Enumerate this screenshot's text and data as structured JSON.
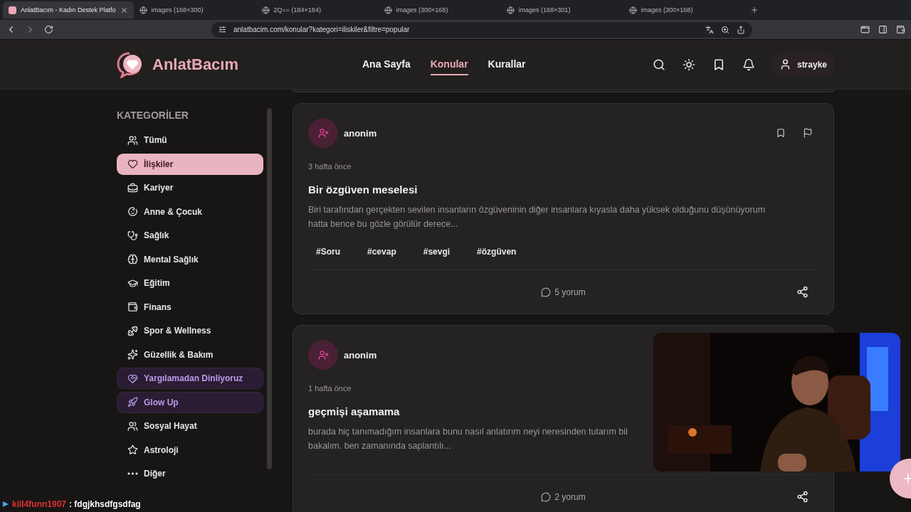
{
  "browser": {
    "tabs": [
      {
        "title": "AnlatBacım - Kadın Destek Platfo",
        "selected": true
      },
      {
        "title": "images (168×300)",
        "selected": false
      },
      {
        "title": "2Q== (184×184)",
        "selected": false
      },
      {
        "title": "images (300×168)",
        "selected": false
      },
      {
        "title": "images (168×301)",
        "selected": false
      },
      {
        "title": "images (300×168)",
        "selected": false
      }
    ],
    "address": "anlatbacim.com/konular?kategori=iliskiler&filtre=popular"
  },
  "site": {
    "logo": "AnlatBacım",
    "nav": [
      {
        "label": "Ana Sayfa",
        "selected": false
      },
      {
        "label": "Konular",
        "selected": true
      },
      {
        "label": "Kurallar",
        "selected": false
      }
    ],
    "user": "strayke"
  },
  "sidebar": {
    "title": "KATEGORİLER",
    "items": [
      {
        "label": "Tümü",
        "kind": "plain",
        "selected": false
      },
      {
        "label": "İlişkiler",
        "kind": "plain",
        "selected": true
      },
      {
        "label": "Kariyer",
        "kind": "plain",
        "selected": false
      },
      {
        "label": "Anne & Çocuk",
        "kind": "plain",
        "selected": false
      },
      {
        "label": "Sağlık",
        "kind": "plain",
        "selected": false
      },
      {
        "label": "Mental Sağlık",
        "kind": "plain",
        "selected": false
      },
      {
        "label": "Eğitim",
        "kind": "plain",
        "selected": false
      },
      {
        "label": "Finans",
        "kind": "plain",
        "selected": false
      },
      {
        "label": "Spor & Wellness",
        "kind": "plain",
        "selected": false
      },
      {
        "label": "Güzellik & Bakım",
        "kind": "plain",
        "selected": false
      },
      {
        "label": "Yargılamadan Dinliyoruz",
        "kind": "featured",
        "selected": false
      },
      {
        "label": "Glow Up",
        "kind": "featured",
        "selected": false
      },
      {
        "label": "Sosyal Hayat",
        "kind": "plain",
        "selected": false
      },
      {
        "label": "Astroloji",
        "kind": "plain",
        "selected": false
      },
      {
        "label": "Diğer",
        "kind": "plain",
        "selected": false
      }
    ]
  },
  "posts": [
    {
      "author": "anonim",
      "time": "3 hafta önce",
      "title": "Bir özgüven meselesi",
      "body": "Biri tarafından gerçekten sevilen insanların özgüveninin diğer insanlara kıyasla daha yüksek olduğunu düşünüyorum\nhatta bence bu gözle görülür derece...",
      "tags": [
        "#Soru",
        "#cevap",
        "#sevgi",
        "#özgüven"
      ],
      "comments": "5 yorum"
    },
    {
      "author": "anonim",
      "time": "1 hafta önce",
      "title": "geçmişi aşamama",
      "body": "burada hiç tanımadığım insanlara bunu nasıl anlatırım neyi neresinden tutarım bil\nbakalım. ben zamanında saplantılı...",
      "comments": "2 yorum"
    }
  ],
  "overlays": {
    "chat": {
      "user": "kill4funn1907",
      "message": ": fdgjkhsdfgsdfag"
    }
  }
}
